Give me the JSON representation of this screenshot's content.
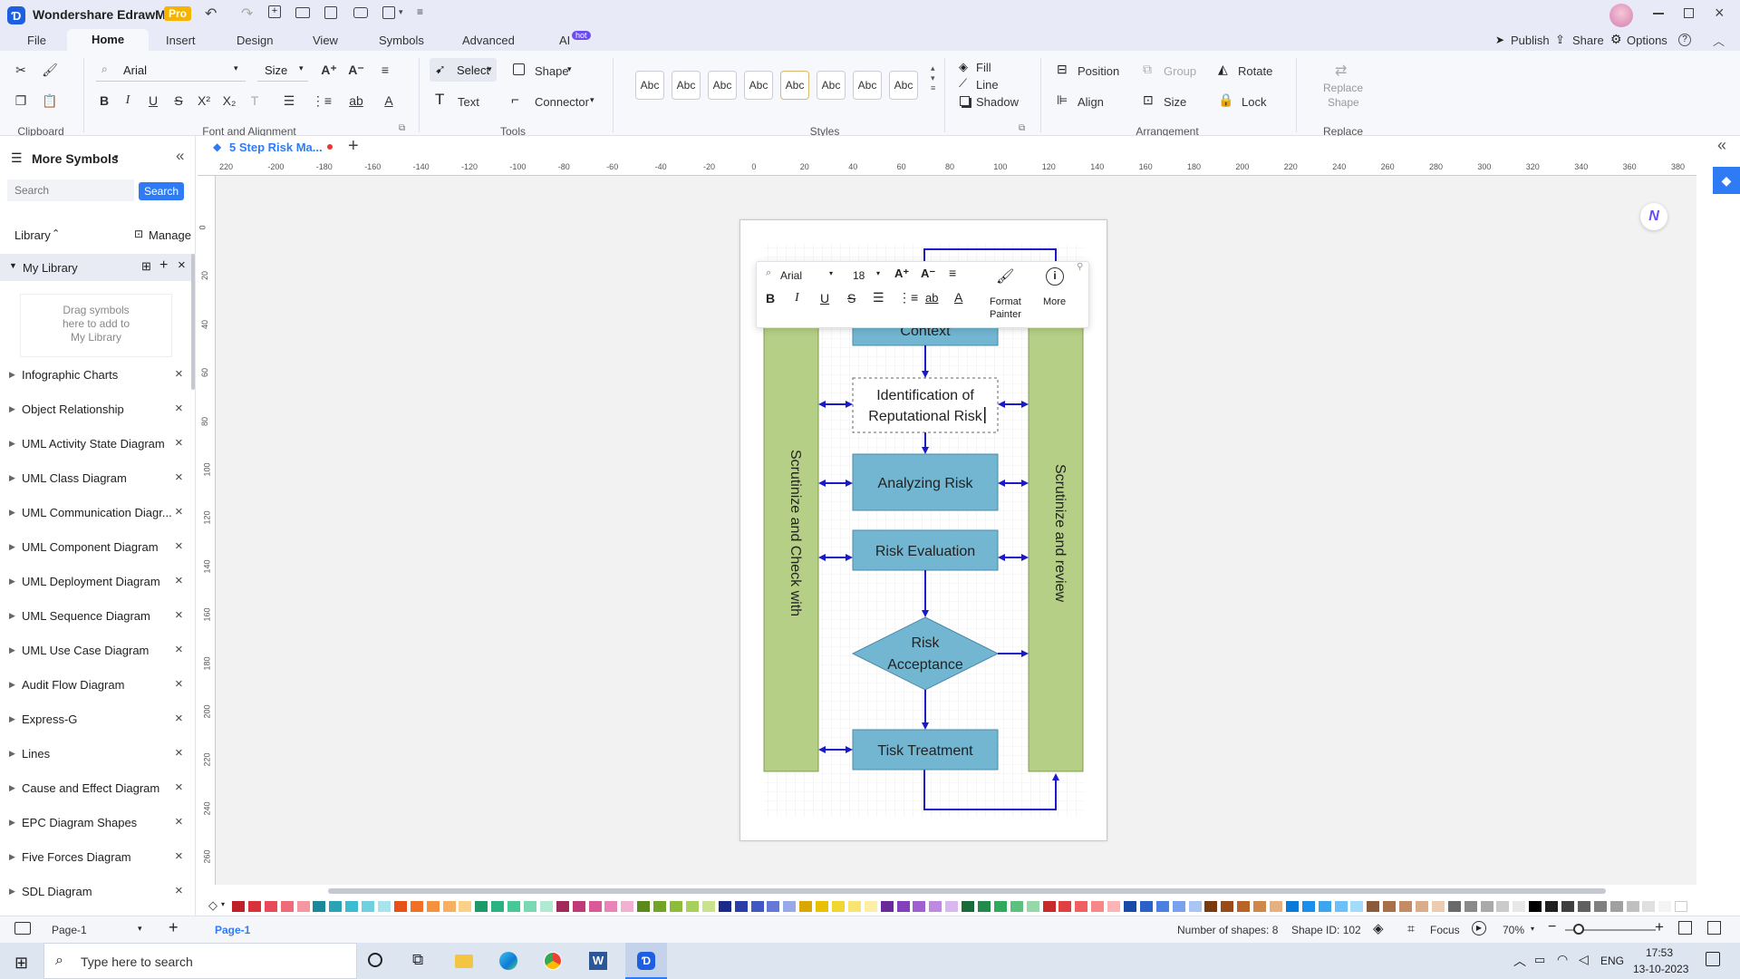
{
  "app": {
    "title": "Wondershare EdrawMax",
    "badge": "Pro"
  },
  "menu": {
    "file": "File",
    "home": "Home",
    "insert": "Insert",
    "design": "Design",
    "view": "View",
    "symbols": "Symbols",
    "advanced": "Advanced",
    "ai": "AI",
    "ai_badge": "hot",
    "publish": "Publish",
    "share": "Share",
    "options": "Options"
  },
  "ribbon": {
    "font": "Arial",
    "size": "Size",
    "select": "Select",
    "shape": "Shape",
    "text": "Text",
    "connector": "Connector",
    "style_label": "Abc",
    "fill": "Fill",
    "line": "Line",
    "shadow": "Shadow",
    "position": "Position",
    "group": "Group",
    "rotate": "Rotate",
    "align": "Align",
    "lock": "Lock",
    "replace_shape_1": "Replace",
    "replace_shape_2": "Shape",
    "groups": {
      "clipboard": "Clipboard",
      "font": "Font and Alignment",
      "tools": "Tools",
      "styles": "Styles",
      "arrangement": "Arrangement",
      "replace": "Replace"
    }
  },
  "panel": {
    "title": "More Symbols",
    "search_placeholder": "Search",
    "search_btn": "Search",
    "library": "Library",
    "manage": "Manage",
    "my_library": "My Library",
    "drag_1": "Drag symbols",
    "drag_2": "here to add to",
    "drag_3": "My Library",
    "items": [
      "Infographic Charts",
      "Object Relationship",
      "UML Activity State Diagram",
      "UML Class Diagram",
      "UML Communication Diagr...",
      "UML Component Diagram",
      "UML Deployment Diagram",
      "UML Sequence Diagram",
      "UML Use Case Diagram",
      "Audit Flow Diagram",
      "Express-G",
      "Lines",
      "Cause and Effect Diagram",
      "EPC Diagram Shapes",
      "Five Forces Diagram",
      "SDL Diagram"
    ]
  },
  "doc": {
    "tab": "5 Step Risk Ma..."
  },
  "ruler": {
    "h": [
      "220",
      "-200",
      "-180",
      "-160",
      "-140",
      "-120",
      "-100",
      "-80",
      "-60",
      "-40",
      "-20",
      "0",
      "20",
      "40",
      "60",
      "80",
      "100",
      "120",
      "140",
      "160",
      "180",
      "200",
      "220",
      "240",
      "260",
      "280",
      "300",
      "320",
      "340",
      "360",
      "380"
    ],
    "v": [
      "0",
      "20",
      "40",
      "60",
      "80",
      "100",
      "120",
      "140",
      "160",
      "180",
      "200",
      "220",
      "240",
      "260"
    ]
  },
  "diagram": {
    "context": "Context",
    "ident_1": "Identification of",
    "ident_2": "Reputational Risk",
    "analyzing": "Analyzing Risk",
    "evaluation": "Risk Evaluation",
    "accept_1": "Risk",
    "accept_2": "Acceptance",
    "treatment": "Tisk Treatment",
    "left_side": "Scrutinize and Check with",
    "right_side": "Scrutinize and review"
  },
  "float_toolbar": {
    "font": "Arial",
    "size": "18",
    "format_1": "Format",
    "format_2": "Painter",
    "more": "More"
  },
  "palette_colors": [
    "#c0202a",
    "#d9303a",
    "#e84a5a",
    "#f06b7a",
    "#f497a2",
    "#1a8a9a",
    "#2aa3b4",
    "#3cbcd0",
    "#6fd1e0",
    "#a8e4ee",
    "#e8501a",
    "#f07026",
    "#f59240",
    "#f8b060",
    "#fbd08a",
    "#1c9a6a",
    "#2ab380",
    "#46c898",
    "#7ad9b4",
    "#b0ead2",
    "#a02a5a",
    "#c03a78",
    "#d85a98",
    "#e884b8",
    "#f2b0d2",
    "#5a8a1a",
    "#72a428",
    "#8cbc3a",
    "#a8d05c",
    "#c8e28e",
    "#1a2a8a",
    "#2a3ea8",
    "#4058c4",
    "#6478d8",
    "#98a8e8",
    "#d8a800",
    "#e8c000",
    "#f2d630",
    "#f8e470",
    "#fcf0a8",
    "#6a2a9a",
    "#8440b8",
    "#a060d0",
    "#bc8ae0",
    "#d8b8ee",
    "#1a6a3a",
    "#228a4a",
    "#30a85e",
    "#5cc07e",
    "#96d8a8",
    "#c82a2a",
    "#e04040",
    "#f06060",
    "#f88888",
    "#fcb4b4",
    "#1a4aa8",
    "#2a62c8",
    "#4a80e0",
    "#78a2ec",
    "#aac4f4",
    "#7a3a10",
    "#9a4c18",
    "#b86428",
    "#d08848",
    "#e6b080",
    "#0a7ad8",
    "#1a8ee8",
    "#3aa6f0",
    "#6cc0f6",
    "#a4dafa",
    "#8a5a3a",
    "#a87048",
    "#c48c64",
    "#daac8a",
    "#eccdb4",
    "#6a6a6a",
    "#8a8a8a",
    "#aaaaaa",
    "#cacaca",
    "#e8e8e8",
    "#000000",
    "#202020",
    "#404040",
    "#606060",
    "#808080",
    "#a0a0a0",
    "#c0c0c0",
    "#e0e0e0",
    "#f4f4f4",
    "#ffffff"
  ],
  "status": {
    "page_select": "Page-1",
    "page_tab": "Page-1",
    "shapes": "Number of shapes: 8",
    "shape_id": "Shape ID: 102",
    "focus": "Focus",
    "zoom": "70%"
  },
  "taskbar": {
    "search": "Type here to search",
    "lang": "ENG",
    "time": "17:53",
    "date": "13-10-2023"
  }
}
